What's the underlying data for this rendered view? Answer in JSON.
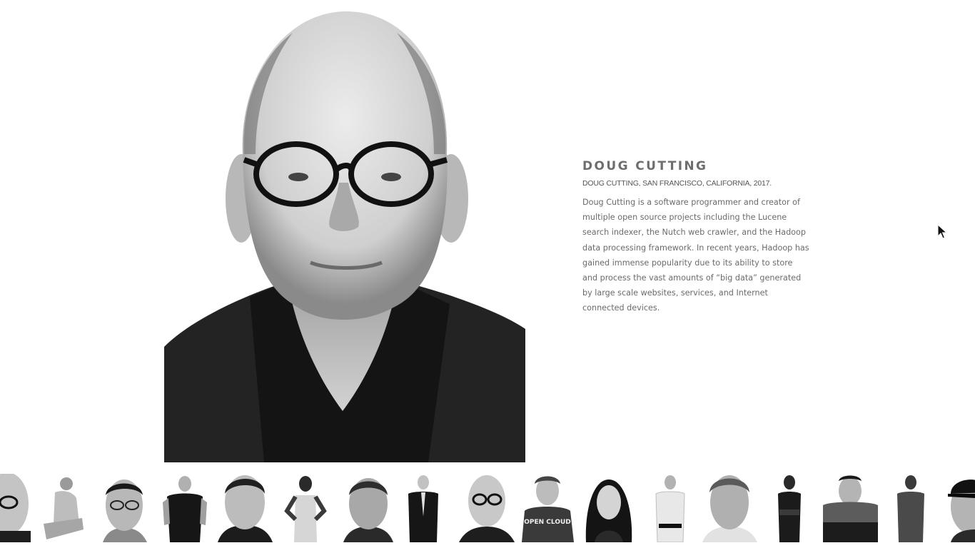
{
  "person": {
    "name": "DOUG CUTTING",
    "caption": "DOUG CUTTING, SAN FRANCISCO, CALIFORNIA, 2017.",
    "bio": "Doug Cutting is a software programmer and creator of multiple open source projects including the Lucene search indexer, the Nutch web crawler, and the Hadoop data processing framework. In recent years, Hadoop has gained immense popularity due to its ability to store and process the vast amounts of “big data” generated by large scale websites, services, and Internet connected devices."
  },
  "thumbnails": [
    {
      "id": "thumb-1"
    },
    {
      "id": "thumb-2"
    },
    {
      "id": "thumb-3"
    },
    {
      "id": "thumb-4"
    },
    {
      "id": "thumb-5"
    },
    {
      "id": "thumb-6"
    },
    {
      "id": "thumb-7"
    },
    {
      "id": "thumb-8"
    },
    {
      "id": "thumb-9"
    },
    {
      "id": "thumb-10"
    },
    {
      "id": "thumb-11"
    },
    {
      "id": "thumb-12"
    },
    {
      "id": "thumb-13"
    },
    {
      "id": "thumb-14"
    },
    {
      "id": "thumb-15"
    },
    {
      "id": "thumb-16"
    },
    {
      "id": "thumb-17"
    }
  ],
  "thumb_texts": {
    "shirt": "OPEN CLOUD"
  },
  "colors": {
    "background": "#ffffff",
    "heading": "#6e6e6e",
    "body_text": "#6b6b6b",
    "photo_dark": "#1c1c1c"
  }
}
